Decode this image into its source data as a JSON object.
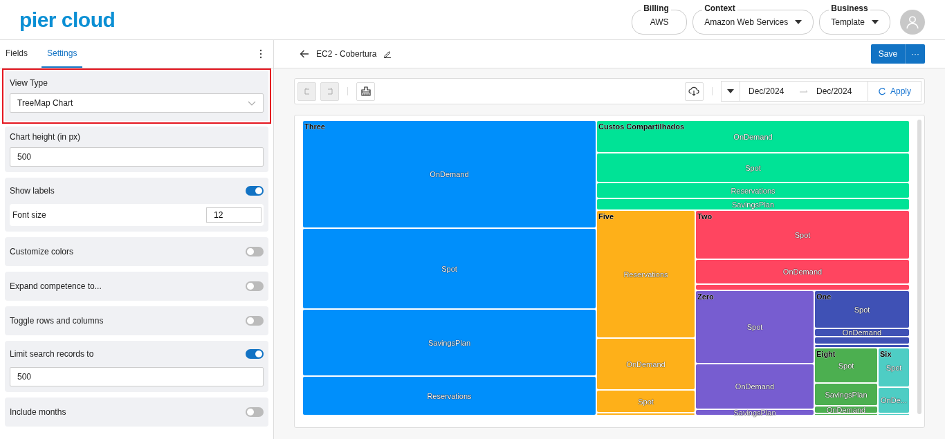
{
  "header": {
    "logo": "pier cloud",
    "selectors": [
      {
        "label": "Billing",
        "value": "AWS",
        "dropdown": false
      },
      {
        "label": "Context",
        "value": "Amazon Web Services",
        "dropdown": true
      },
      {
        "label": "Business",
        "value": "Template",
        "dropdown": true
      }
    ]
  },
  "sidebar": {
    "tabs": [
      {
        "label": "Fields",
        "selected": false
      },
      {
        "label": "Settings",
        "selected": true
      }
    ],
    "settings": [
      {
        "kind": "select",
        "label": "View Type",
        "value": "TreeMap Chart",
        "highlighted": true
      },
      {
        "kind": "input",
        "label": "Chart height (in px)",
        "value": "500",
        "highlighted": false
      },
      {
        "kind": "toggle",
        "label": "Show labels",
        "on": true,
        "sub_label": "Font size",
        "sub_value": "12",
        "highlighted": false
      },
      {
        "kind": "toggle",
        "label": "Customize colors",
        "on": false,
        "highlighted": false
      },
      {
        "kind": "toggle",
        "label": "Expand competence to...",
        "on": false,
        "highlighted": false
      },
      {
        "kind": "toggle",
        "label": "Toggle rows and columns",
        "on": false,
        "highlighted": false
      },
      {
        "kind": "toggle",
        "label": "Limit search records to",
        "on": true,
        "field_value": "500",
        "highlighted": false
      },
      {
        "kind": "toggle",
        "label": "Include months",
        "on": false,
        "highlighted": false
      }
    ]
  },
  "report": {
    "title": "EC2 - Cobertura",
    "save": "Save",
    "more": "···",
    "toolbar": {
      "undo_disabled": true,
      "redo_disabled": true,
      "date_from": "Dec/2024",
      "date_to": "Dec/2024",
      "apply": "Apply"
    },
    "treemap": {
      "groups": [
        {
          "name": "Three",
          "color": "#008ffb",
          "tiles": [
            {
              "label": "OnDemand"
            },
            {
              "label": "Spot"
            },
            {
              "label": "SavingsPlan"
            },
            {
              "label": "Reservations"
            }
          ]
        },
        {
          "name": "Custos Compartilhados",
          "color": "#00e396",
          "tiles": [
            {
              "label": "OnDemand"
            },
            {
              "label": "Spot"
            },
            {
              "label": "Reservations"
            },
            {
              "label": "SavingsPlan"
            }
          ]
        },
        {
          "name": "Five",
          "color": "#feb019",
          "tiles": [
            {
              "label": "Reservations"
            },
            {
              "label": "OnDemand"
            },
            {
              "label": "Spot"
            }
          ]
        },
        {
          "name": "Two",
          "color": "#ff4560",
          "tiles": [
            {
              "label": "Spot"
            },
            {
              "label": "OnDemand"
            }
          ]
        },
        {
          "name": "Zero",
          "color": "#775dd0",
          "tiles": [
            {
              "label": "Spot"
            },
            {
              "label": "OnDemand"
            },
            {
              "label": "SavingsPlan"
            }
          ]
        },
        {
          "name": "One",
          "color": "#3f51b5",
          "tiles": [
            {
              "label": "Spot"
            },
            {
              "label": "OnDemand"
            }
          ]
        },
        {
          "name": "Eight",
          "color": "#4caf50",
          "tiles": [
            {
              "label": "Spot"
            },
            {
              "label": "SavingsPlan"
            },
            {
              "label": "OnDemand"
            }
          ]
        },
        {
          "name": "Six",
          "color": "#4ecdc4",
          "tiles": [
            {
              "label": "Spot"
            },
            {
              "label": "OnDe..."
            }
          ]
        }
      ]
    }
  }
}
